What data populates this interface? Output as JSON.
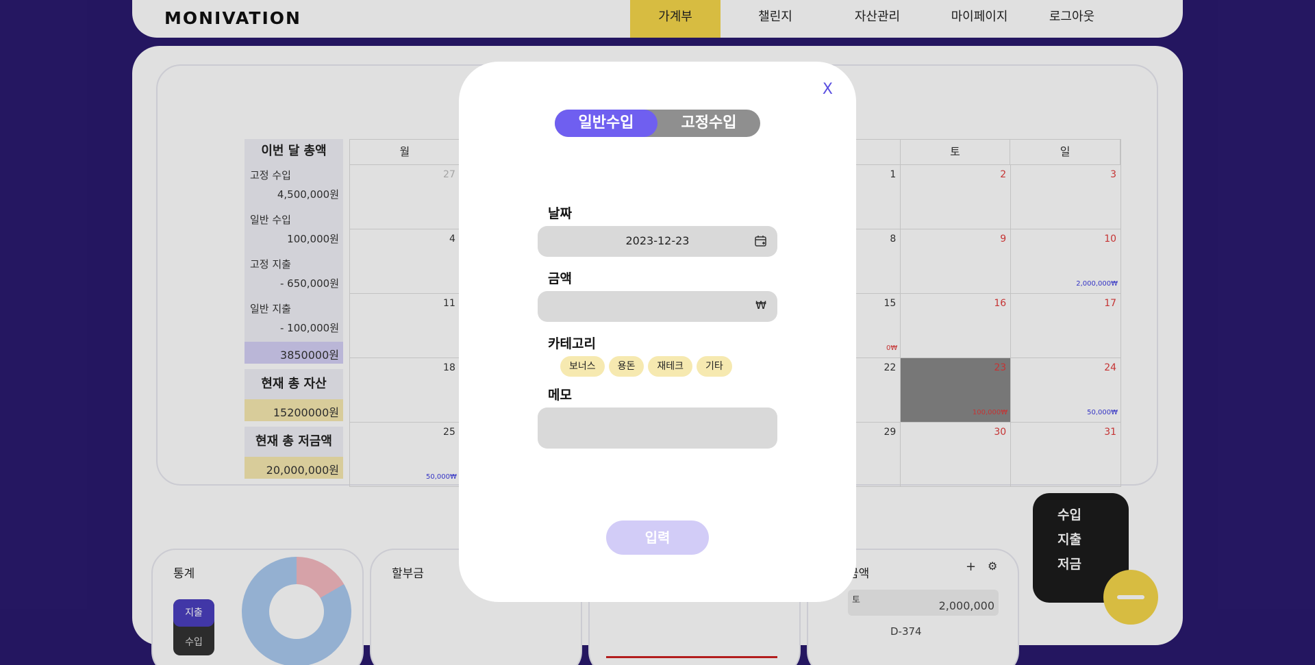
{
  "header": {
    "logo": "MONIVATION",
    "nav": [
      {
        "label": "가계부",
        "active": true
      },
      {
        "label": "챌린지",
        "active": false
      },
      {
        "label": "자산관리",
        "active": false
      },
      {
        "label": "마이페이지",
        "active": false
      },
      {
        "label": "로그아웃",
        "active": false
      }
    ]
  },
  "summary": {
    "title": "이번 달 총액",
    "rows": [
      {
        "label": "고정 수입",
        "value": "4,500,000원"
      },
      {
        "label": "일반 수입",
        "value": "100,000원"
      },
      {
        "label": "고정 지출",
        "value": "- 650,000원"
      },
      {
        "label": "일반 지출",
        "value": "- 100,000원"
      }
    ],
    "total": "3850000원",
    "assets_title": "현재 총 자산",
    "assets_value": "15200000원",
    "savings_title": "현재 총 저금액",
    "savings_value": "20,000,000원"
  },
  "calendar": {
    "weekdays": [
      "월",
      "",
      "",
      "",
      "",
      "토",
      "일"
    ],
    "rows": [
      [
        {
          "n": "27",
          "t": "gray"
        },
        {
          "n": ""
        },
        {
          "n": ""
        },
        {
          "n": ""
        },
        {
          "n": "1"
        },
        {
          "n": "2",
          "t": "red"
        },
        {
          "n": "3",
          "t": "red"
        }
      ],
      [
        {
          "n": "4"
        },
        {
          "n": ""
        },
        {
          "n": ""
        },
        {
          "n": ""
        },
        {
          "n": "8"
        },
        {
          "n": "9",
          "t": "red"
        },
        {
          "n": "10",
          "t": "red",
          "amt": "2,000,000₩"
        }
      ],
      [
        {
          "n": "11"
        },
        {
          "n": ""
        },
        {
          "n": ""
        },
        {
          "n": ""
        },
        {
          "n": "15",
          "amt": "0₩",
          "amtRed": true
        },
        {
          "n": "16",
          "t": "red"
        },
        {
          "n": "17",
          "t": "red"
        }
      ],
      [
        {
          "n": "18"
        },
        {
          "n": ""
        },
        {
          "n": ""
        },
        {
          "n": ""
        },
        {
          "n": "22"
        },
        {
          "n": "23",
          "t": "red",
          "dark": true,
          "amt": "100,000₩",
          "amtRed": true
        },
        {
          "n": "24",
          "t": "red",
          "amt": "50,000₩"
        }
      ],
      [
        {
          "n": "25",
          "amt": "50,000₩"
        },
        {
          "n": ""
        },
        {
          "n": ""
        },
        {
          "n": ""
        },
        {
          "n": "29"
        },
        {
          "n": "30",
          "t": "red"
        },
        {
          "n": "31",
          "t": "red"
        }
      ]
    ]
  },
  "stats": {
    "title": "통계",
    "tab_expense": "지출",
    "tab_income": "수입"
  },
  "installments": {
    "title": "할부금"
  },
  "savings_widget": {
    "title": "금액",
    "bank": "토",
    "amount": "2,000,000",
    "dday": "D-374"
  },
  "side_menu": [
    "수입",
    "지출",
    "저금"
  ],
  "modal": {
    "close": "X",
    "tabs": {
      "general": "일반수입",
      "fixed": "고정수입"
    },
    "date_label": "날짜",
    "date_value": "2023-12-23",
    "amount_label": "금액",
    "currency": "₩",
    "category_label": "카테고리",
    "categories": [
      "보너스",
      "용돈",
      "재테크",
      "기타"
    ],
    "memo_label": "메모",
    "submit": "입력"
  }
}
